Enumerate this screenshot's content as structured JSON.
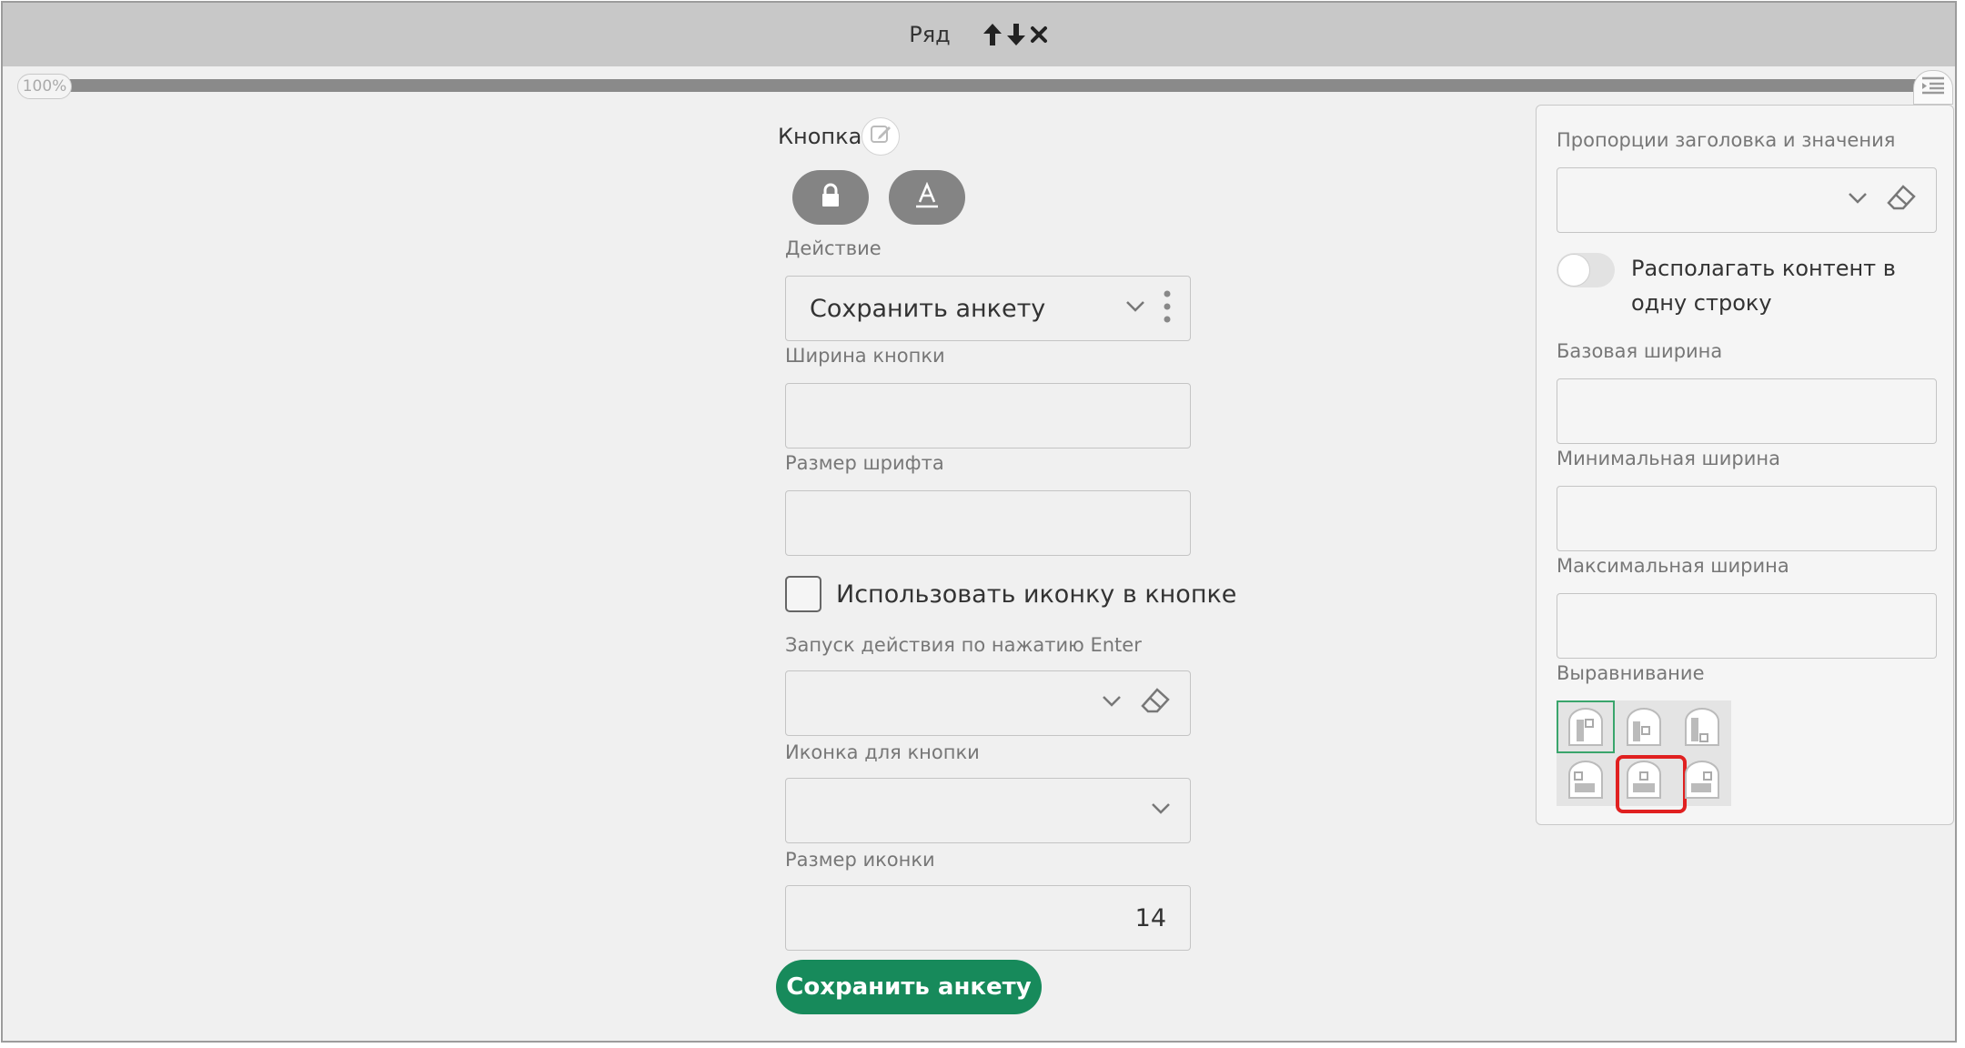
{
  "topbar": {
    "title": "Ряд",
    "icons": [
      "arrow-up-icon",
      "arrow-down-icon",
      "close-icon"
    ]
  },
  "zoom": {
    "label": "100%"
  },
  "editor": {
    "element_name": "Кнопка",
    "pill_icons": [
      "lock-icon",
      "text-style-icon"
    ],
    "action": {
      "label": "Действие",
      "value": "Сохранить анкету"
    },
    "button_width": {
      "label": "Ширина кнопки",
      "value": ""
    },
    "font_size": {
      "label": "Размер шрифта",
      "value": ""
    },
    "use_icon": {
      "label": "Использовать иконку в кнопке",
      "checked": false
    },
    "enter_action": {
      "label": "Запуск действия по нажатию Enter",
      "value": ""
    },
    "button_icon": {
      "label": "Иконка для кнопки",
      "value": ""
    },
    "icon_size": {
      "label": "Размер иконки",
      "value": "14"
    },
    "preview_button": {
      "label": "Сохранить анкету",
      "color": "#178a5b"
    }
  },
  "panel": {
    "proportions": {
      "label": "Пропорции заголовка и значения",
      "value": ""
    },
    "single_line": {
      "label": "Располагать контент в одну строку",
      "enabled": false
    },
    "base_width": {
      "label": "Базовая ширина",
      "value": ""
    },
    "min_width": {
      "label": "Минимальная ширина",
      "value": ""
    },
    "max_width": {
      "label": "Максимальная ширина",
      "value": ""
    },
    "alignment": {
      "label": "Выравнивание",
      "options": [
        "top-left",
        "top-center",
        "top-right",
        "bottom-left",
        "bottom-center",
        "bottom-right"
      ],
      "selected": "top-left",
      "highlighted": "bottom-center"
    }
  },
  "colors": {
    "accent": "#178a5b",
    "highlight": "#e02020",
    "selected_outline": "#3aa56c"
  }
}
